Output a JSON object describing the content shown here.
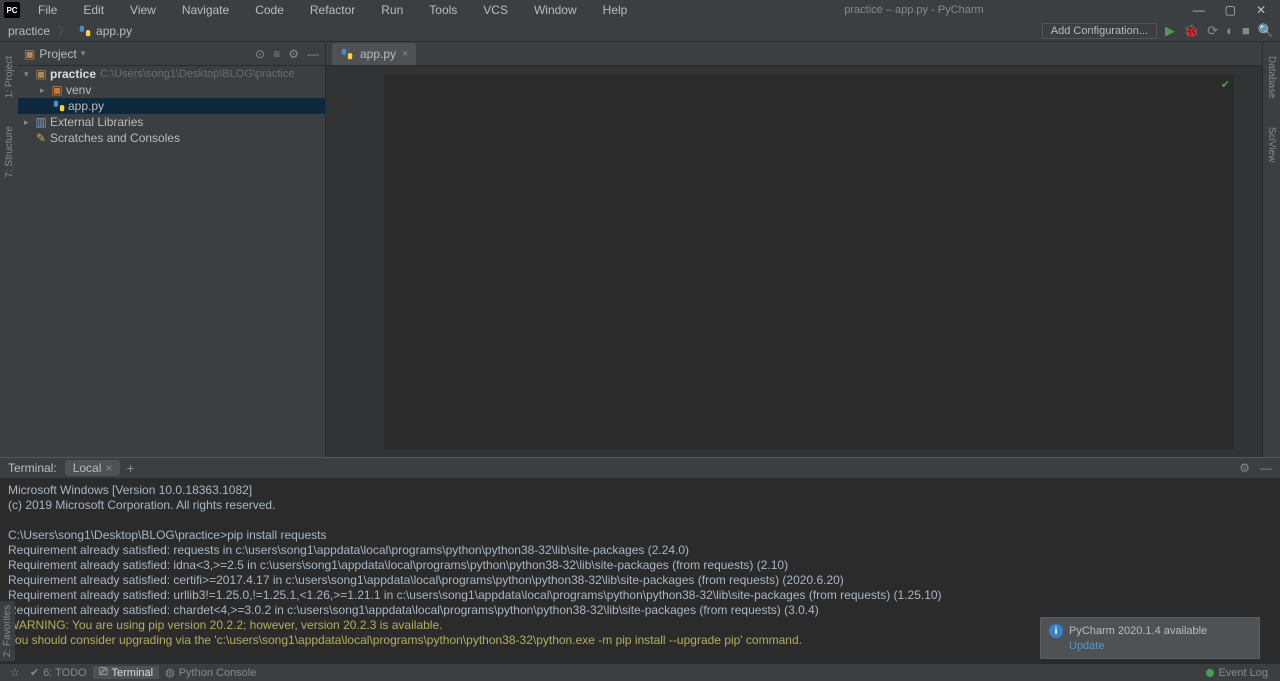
{
  "titlebar": {
    "menus": [
      "File",
      "Edit",
      "View",
      "Navigate",
      "Code",
      "Refactor",
      "Run",
      "Tools",
      "VCS",
      "Window",
      "Help"
    ],
    "title": "practice – app.py - PyCharm"
  },
  "breadcrumb": {
    "root": "practice",
    "file": "app.py"
  },
  "toolbar": {
    "add_config": "Add Configuration...",
    "search_icon": "🔍"
  },
  "left_tabs": {
    "project": "1: Project",
    "structure": "7: Structure"
  },
  "right_tabs": {
    "database": "Database",
    "sciview": "SciView"
  },
  "project": {
    "title": "Project",
    "root": {
      "name": "practice",
      "path": "C:\\Users\\song1\\Desktop\\BLOG\\practice"
    },
    "items": [
      {
        "name": "venv",
        "kind": "folder"
      },
      {
        "name": "app.py",
        "kind": "py",
        "selected": true
      }
    ],
    "external": "External Libraries",
    "scratches": "Scratches and Consoles"
  },
  "editor_tabs": [
    {
      "name": "app.py"
    }
  ],
  "terminal": {
    "label": "Terminal:",
    "tab": "Local",
    "lines": [
      "Microsoft Windows [Version 10.0.18363.1082]",
      "(c) 2019 Microsoft Corporation. All rights reserved.",
      "",
      "C:\\Users\\song1\\Desktop\\BLOG\\practice>pip install requests",
      "Requirement already satisfied: requests in c:\\users\\song1\\appdata\\local\\programs\\python\\python38-32\\lib\\site-packages (2.24.0)",
      "Requirement already satisfied: idna<3,>=2.5 in c:\\users\\song1\\appdata\\local\\programs\\python\\python38-32\\lib\\site-packages (from requests) (2.10)",
      "Requirement already satisfied: certifi>=2017.4.17 in c:\\users\\song1\\appdata\\local\\programs\\python\\python38-32\\lib\\site-packages (from requests) (2020.6.20)",
      "Requirement already satisfied: urllib3!=1.25.0,!=1.25.1,<1.26,>=1.21.1 in c:\\users\\song1\\appdata\\local\\programs\\python\\python38-32\\lib\\site-packages (from requests) (1.25.10)",
      "Requirement already satisfied: chardet<4,>=3.0.2 in c:\\users\\song1\\appdata\\local\\programs\\python\\python38-32\\lib\\site-packages (from requests) (3.0.4)"
    ],
    "warn_lines": [
      "WARNING: You are using pip version 20.2.2; however, version 20.2.3 is available.",
      "You should consider upgrading via the 'c:\\users\\song1\\appdata\\local\\programs\\python\\python38-32\\python.exe -m pip install --upgrade pip' command."
    ],
    "prompt": "C:\\Users\\song1\\Desktop\\BLOG\\practice>"
  },
  "status": {
    "todo": "6: TODO",
    "terminal": "Terminal",
    "python_console": "Python Console",
    "event_log": "Event Log",
    "favorites": "2: Favorites"
  },
  "popup": {
    "title": "PyCharm 2020.1.4 available",
    "action": "Update"
  }
}
